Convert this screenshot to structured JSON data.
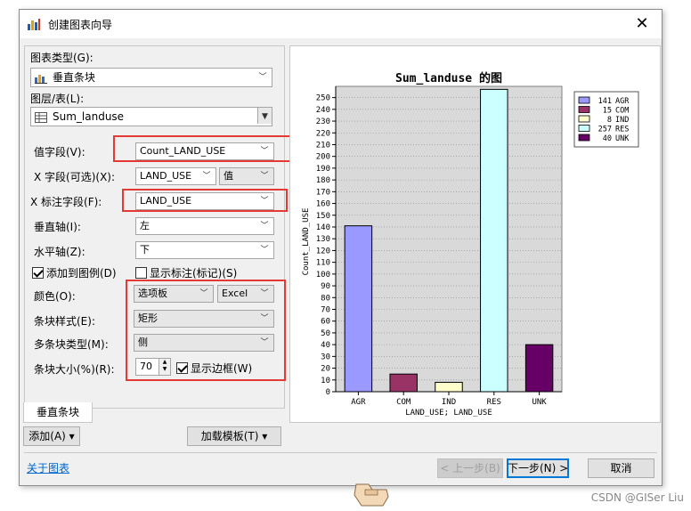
{
  "window": {
    "title": "创建图表向导",
    "close_glyph": "✕"
  },
  "form": {
    "chart_type": {
      "label": "图表类型(G):",
      "value": "垂直条块"
    },
    "layer": {
      "label": "图层/表(L):",
      "value": "Sum_landuse"
    },
    "value_field": {
      "label": "值字段(V):",
      "value": "Count_LAND_USE"
    },
    "x_field": {
      "label": "X 字段(可选)(X):",
      "value": "LAND_USE",
      "sort": "值"
    },
    "x_label_field": {
      "label": "X 标注字段(F):",
      "value": "LAND_USE"
    },
    "vertical_axis": {
      "label": "垂直轴(I):",
      "value": "左"
    },
    "horizontal_axis": {
      "label": "水平轴(Z):",
      "value": "下"
    },
    "add_to_legend": {
      "label": "添加到图例(D)",
      "checked": true
    },
    "show_labels": {
      "label": "显示标注(标记)(S)",
      "checked": false
    },
    "color": {
      "label": "颜色(O):",
      "value": "选项板",
      "palette": "Excel"
    },
    "bar_style": {
      "label": "条块样式(E):",
      "value": "矩形"
    },
    "multi_bar_type": {
      "label": "多条块类型(M):",
      "value": "侧"
    },
    "bar_size": {
      "label": "条块大小(%)(R):",
      "value": "70"
    },
    "show_border": {
      "label": "显示边框(W)",
      "checked": true
    }
  },
  "tab": {
    "label": "垂直条块"
  },
  "buttons": {
    "add": "添加(A) ▾",
    "load_template": "加载模板(T)  ▾",
    "prev": "< 上一步(B)",
    "next": "下一步(N) >",
    "cancel": "取消"
  },
  "about_link": "关于图表",
  "watermark": "CSDN @GISer Liu",
  "chart_data": {
    "type": "bar",
    "title": "Sum_landuse 的图",
    "xlabel": "LAND_USE; LAND_USE",
    "ylabel": "Count_LAND_USE",
    "categories": [
      "AGR",
      "COM",
      "IND",
      "RES",
      "UNK"
    ],
    "values": [
      141,
      15,
      8,
      257,
      40
    ],
    "colors": [
      "#9999ff",
      "#993366",
      "#ffffcc",
      "#ccffff",
      "#660066"
    ],
    "ylim": [
      0,
      255
    ],
    "ytick_step": 10,
    "grid": true,
    "legend_position": "top-right",
    "legend": [
      {
        "count": "141",
        "name": "AGR"
      },
      {
        "count": "15",
        "name": "COM"
      },
      {
        "count": "8",
        "name": "IND"
      },
      {
        "count": "257",
        "name": "RES"
      },
      {
        "count": "40",
        "name": "UNK"
      }
    ]
  }
}
